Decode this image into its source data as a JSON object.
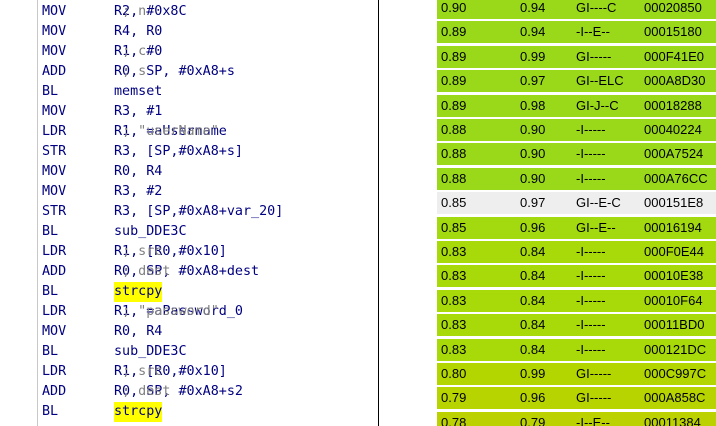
{
  "disassembly": {
    "lines": [
      {
        "mnemonic": "MOV",
        "operands": "R2, #0x8C",
        "comment": "; n"
      },
      {
        "mnemonic": "MOV",
        "operands": "R4, R0",
        "comment": ""
      },
      {
        "mnemonic": "MOV",
        "operands": "R1, #0",
        "comment": "; c"
      },
      {
        "mnemonic": "ADD",
        "operands": "R0, SP, #0xA8+s",
        "comment": "; s"
      },
      {
        "mnemonic": "BL",
        "operands": "memset",
        "comment": ""
      },
      {
        "mnemonic": "MOV",
        "operands": "R3, #1",
        "comment": ""
      },
      {
        "mnemonic": "LDR",
        "operands": "R1, =aUsername",
        "comment": "; \"userName\""
      },
      {
        "mnemonic": "STR",
        "operands": "R3, [SP,#0xA8+s]",
        "comment": ""
      },
      {
        "mnemonic": "MOV",
        "operands": "R0, R4",
        "comment": ""
      },
      {
        "mnemonic": "MOV",
        "operands": "R3, #2",
        "comment": ""
      },
      {
        "mnemonic": "STR",
        "operands": "R3, [SP,#0xA8+var_20]",
        "comment": ""
      },
      {
        "mnemonic": "BL",
        "operands": "sub_DDE3C",
        "comment": ""
      },
      {
        "mnemonic": "LDR",
        "operands": "R1, [R0,#0x10]",
        "comment": "; src"
      },
      {
        "mnemonic": "ADD",
        "operands": "R0, SP, #0xA8+dest",
        "comment": "; dest"
      },
      {
        "mnemonic": "BL",
        "operands": "strcpy",
        "comment": "",
        "highlight": true
      },
      {
        "mnemonic": "LDR",
        "operands": "R1, =aPassword_0",
        "comment": "; \"password\""
      },
      {
        "mnemonic": "MOV",
        "operands": "R0, R4",
        "comment": ""
      },
      {
        "mnemonic": "BL",
        "operands": "sub_DDE3C",
        "comment": ""
      },
      {
        "mnemonic": "LDR",
        "operands": "R1, [R0,#0x10]",
        "comment": "; src"
      },
      {
        "mnemonic": "ADD",
        "operands": "R0, SP, #0xA8+s2",
        "comment": "; dest"
      },
      {
        "mnemonic": "BL",
        "operands": "strcpy",
        "comment": "",
        "highlight": true
      }
    ]
  },
  "results": {
    "rows": [
      {
        "similarity": "0.90",
        "confidence": "0.94",
        "flags": "GI----C",
        "address": "00020850",
        "color": "#99d91a"
      },
      {
        "similarity": "0.89",
        "confidence": "0.94",
        "flags": "-I--E--",
        "address": "00015180",
        "color": "#99d91a"
      },
      {
        "similarity": "0.89",
        "confidence": "0.99",
        "flags": "GI-----",
        "address": "000F41E0",
        "color": "#99d91a"
      },
      {
        "similarity": "0.89",
        "confidence": "0.97",
        "flags": "GI--ELC",
        "address": "000A8D30",
        "color": "#99d91a"
      },
      {
        "similarity": "0.89",
        "confidence": "0.98",
        "flags": "GI-J--C",
        "address": "00018288",
        "color": "#99d91a"
      },
      {
        "similarity": "0.88",
        "confidence": "0.90",
        "flags": "-I-----",
        "address": "00040224",
        "color": "#99d91a"
      },
      {
        "similarity": "0.88",
        "confidence": "0.90",
        "flags": "-I-----",
        "address": "000A7524",
        "color": "#99d91a"
      },
      {
        "similarity": "0.88",
        "confidence": "0.90",
        "flags": "-I-----",
        "address": "000A76CC",
        "color": "#99d91a"
      },
      {
        "similarity": "0.85",
        "confidence": "0.97",
        "flags": "GI--E-C",
        "address": "000151E8",
        "color": "#eeeeee",
        "selected": true
      },
      {
        "similarity": "0.85",
        "confidence": "0.96",
        "flags": "GI--E--",
        "address": "00016194",
        "color": "#a3d90f"
      },
      {
        "similarity": "0.83",
        "confidence": "0.84",
        "flags": "-I-----",
        "address": "000F0E44",
        "color": "#a8d909"
      },
      {
        "similarity": "0.83",
        "confidence": "0.84",
        "flags": "-I-----",
        "address": "00010E38",
        "color": "#a8d909"
      },
      {
        "similarity": "0.83",
        "confidence": "0.84",
        "flags": "-I-----",
        "address": "00010F64",
        "color": "#a8d909"
      },
      {
        "similarity": "0.83",
        "confidence": "0.84",
        "flags": "-I-----",
        "address": "00011BD0",
        "color": "#a8d909"
      },
      {
        "similarity": "0.83",
        "confidence": "0.84",
        "flags": "-I-----",
        "address": "000121DC",
        "color": "#a8d909"
      },
      {
        "similarity": "0.80",
        "confidence": "0.99",
        "flags": "GI-----",
        "address": "000C997C",
        "color": "#b3d600"
      },
      {
        "similarity": "0.79",
        "confidence": "0.96",
        "flags": "GI-----",
        "address": "000A858C",
        "color": "#b7d400"
      },
      {
        "similarity": "0.78",
        "confidence": "0.79",
        "flags": "-I--E--",
        "address": "00011384",
        "color": "#bcd200"
      }
    ]
  }
}
